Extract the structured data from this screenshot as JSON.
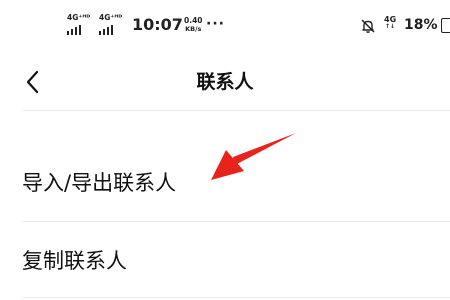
{
  "status_bar": {
    "signal1_label": "4G⁺ᴴᴰ",
    "signal2_label": "4G⁺ᴴᴰ",
    "time": "10:07",
    "net_speed_value": "0.40",
    "net_speed_unit": "KB/s",
    "more": "···",
    "network_label": "4G",
    "network_arrows": "↑↓",
    "battery_percent": "18%",
    "icons": [
      "signal-icon",
      "signal-icon",
      "bell-muted-icon",
      "battery-icon"
    ]
  },
  "nav": {
    "back_icon": "chevron-left-icon",
    "title": "联系人"
  },
  "menu": {
    "items": [
      {
        "label": "导入/导出联系人"
      },
      {
        "label": "复制联系人"
      }
    ]
  },
  "annotation": {
    "type": "red-arrow",
    "color": "#e8231c"
  }
}
